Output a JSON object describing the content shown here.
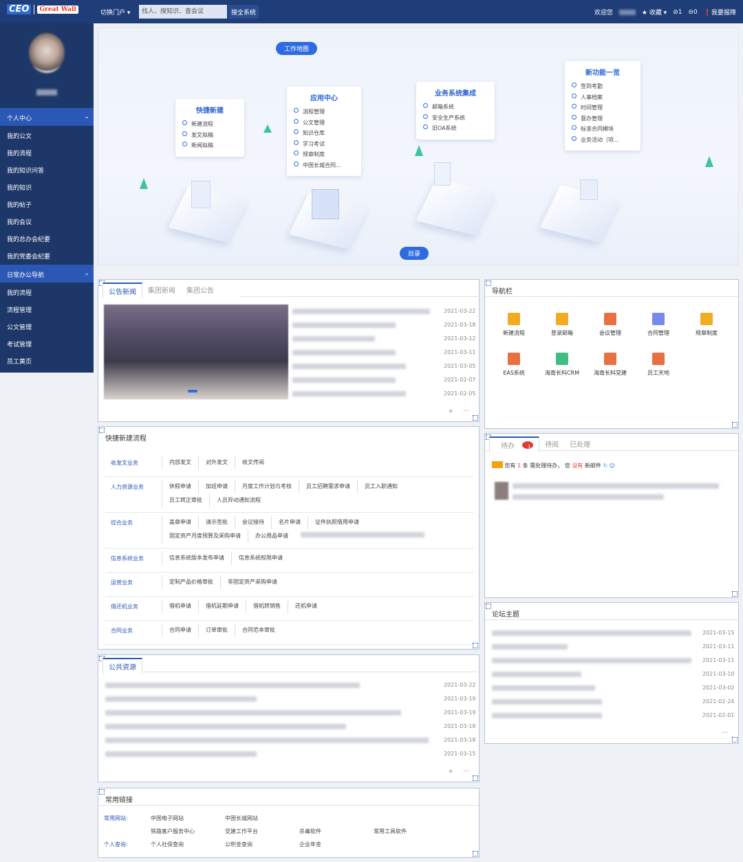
{
  "header": {
    "logo_ceo": "CEO",
    "logo_brand": "Great Wall",
    "switch_portal": "切换门户 ▾",
    "search_placeholder": "找人、搜知识、查会议",
    "search_button": "搜全系统",
    "welcome": "欢迎您",
    "favorites": "收藏 ▾",
    "count1": "1",
    "count2": "0",
    "report": "我要报障"
  },
  "sidebar": {
    "group1": "个人中心",
    "group1_items": [
      "我的公文",
      "我的流程",
      "我的知识问答",
      "我的知识",
      "我的帖子",
      "我的会议",
      "我的总办会纪要",
      "我的党委会纪要"
    ],
    "group2": "日常办公导航",
    "group2_items": [
      "我的流程",
      "流程管理",
      "公文管理",
      "考试管理",
      "员工黄页"
    ]
  },
  "hero": {
    "work_map": "工作地图",
    "toc": "目录",
    "cards": [
      {
        "title": "快捷新建",
        "items": [
          "新建流程",
          "发文拟稿",
          "新闻拟稿"
        ]
      },
      {
        "title": "应用中心",
        "items": [
          "流程管理",
          "公文管理",
          "知识仓库",
          "学习考试",
          "规章制度",
          "中国长城合同..."
        ]
      },
      {
        "title": "业务系统集成",
        "items": [
          "邮箱系统",
          "安全生产系统",
          "旧OA系统"
        ]
      },
      {
        "title": "新功能一览",
        "items": [
          "签到考勤",
          "人事档案",
          "时间管理",
          "督办管理",
          "标准合同模块",
          "业务活动（项..."
        ]
      }
    ]
  },
  "news": {
    "tabs": [
      "公告新闻",
      "集团新闻",
      "集团公告"
    ],
    "dates": [
      "2021-03-22",
      "2021-03-18",
      "2021-03-12",
      "2021-03-11",
      "2021-03-05",
      "2021-02-07",
      "2021-02-05"
    ],
    "more": "···",
    "add": "+"
  },
  "navbar": {
    "title": "导航栏",
    "items": [
      {
        "label": "新建流程",
        "icon": "edit-icon",
        "color": "#f2a20c"
      },
      {
        "label": "登录邮箱",
        "icon": "mail-icon",
        "color": "#f2a20c"
      },
      {
        "label": "会议管理",
        "icon": "meeting-icon",
        "color": "#e8602a"
      },
      {
        "label": "合同管理",
        "icon": "contract-icon",
        "color": "#6a7de8"
      },
      {
        "label": "规章制度",
        "icon": "rules-icon",
        "color": "#f2a20c"
      },
      {
        "label": "EAS系统",
        "icon": "eas-icon",
        "color": "#e8602a"
      },
      {
        "label": "海南长科CRM",
        "icon": "crm-icon",
        "color": "#2bb673"
      },
      {
        "label": "海南长科党建",
        "icon": "party-icon",
        "color": "#e8602a"
      },
      {
        "label": "员工天地",
        "icon": "staff-icon",
        "color": "#e8602a"
      }
    ]
  },
  "quickflow": {
    "title": "快捷新建流程",
    "rows": [
      {
        "cat": "收发文业务",
        "items": [
          [
            "内部发文",
            "对外发文",
            "收文传阅"
          ]
        ]
      },
      {
        "cat": "人力资源业务",
        "items": [
          [
            "休假申请",
            "加班申请",
            "月度工作计划与考核",
            "员工招聘需求申请",
            "员工入职通知"
          ],
          [
            "员工转正审批",
            "人员异动通知流程"
          ]
        ]
      },
      {
        "cat": "综合业务",
        "items": [
          [
            "盖章申请",
            "请示签批",
            "会议接待",
            "名片申请",
            "证件执照借用申请"
          ],
          [
            "固定资产月度预算及采购申请",
            "办公用品申请"
          ]
        ]
      },
      {
        "cat": "信息系统业务",
        "items": [
          [
            "信息系统版本发布申请",
            "信息系统权限申请"
          ]
        ]
      },
      {
        "cat": "运营业务",
        "items": [
          [
            "定制产品价格审批",
            "非固定资产采购申请"
          ]
        ]
      },
      {
        "cat": "借还机业务",
        "items": [
          [
            "借机申请",
            "借机延期申请",
            "借机转销售",
            "还机申请"
          ]
        ]
      },
      {
        "cat": "合同业务",
        "items": [
          [
            "合同申请",
            "订单审批",
            "合同范本审批"
          ]
        ]
      }
    ]
  },
  "todo": {
    "tabs": [
      "待办",
      "待阅",
      "已处理"
    ],
    "badge": "1",
    "msg_a": "您有",
    "msg_count": "1",
    "msg_b": "条",
    "msg_c": "需处理待办，",
    "msg_d": "您",
    "msg_none": "没有",
    "msg_e": "新邮件"
  },
  "public": {
    "title": "公共资源",
    "dates": [
      "2021-03-22",
      "2021-03-19",
      "2021-03-19",
      "2021-03-18",
      "2021-03-18",
      "2021-03-15"
    ],
    "more": "···",
    "add": "+"
  },
  "forum": {
    "title": "论坛主题",
    "dates": [
      "2021-03-15",
      "2021-03-11",
      "2021-03-11",
      "2021-03-10",
      "2021-03-02",
      "2021-02-24",
      "2021-02-01"
    ],
    "more": "···"
  },
  "links": {
    "title": "常用链接",
    "cat1": "常用网站:",
    "cat2": "个人查询:",
    "row1": [
      "中国电子网站",
      "中国长城网站"
    ],
    "row2": [
      "铁路客户服务中心",
      "党建工作平台",
      "杀毒软件",
      "常用工具软件"
    ],
    "row3": [
      "个人社保查询",
      "公积金查询",
      "企业年金"
    ]
  }
}
